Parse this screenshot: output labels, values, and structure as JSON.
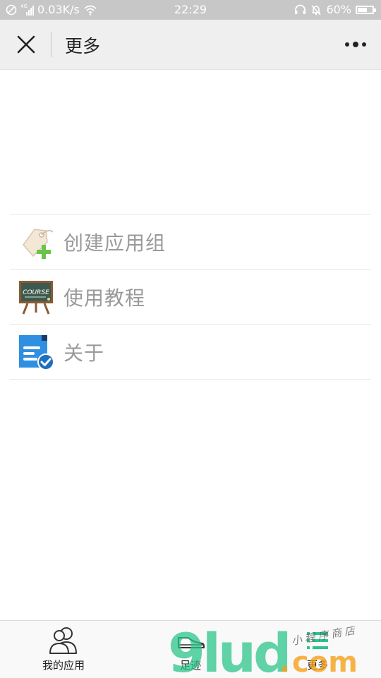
{
  "status_bar": {
    "signal_label": "4G",
    "speed": "0.03K/s",
    "time": "22:29",
    "battery_percent": "60%",
    "battery_level": 0.6
  },
  "navbar": {
    "title": "更多"
  },
  "menu": {
    "items": [
      {
        "label": "创建应用组",
        "icon": "tag-plus-icon"
      },
      {
        "label": "使用教程",
        "icon": "course-blackboard-icon"
      },
      {
        "label": "关于",
        "icon": "document-check-icon"
      }
    ]
  },
  "tabbar": {
    "tabs": [
      {
        "label": "我的应用",
        "icon": "users-icon"
      },
      {
        "label": "足迹",
        "icon": "shoe-icon"
      },
      {
        "label": "更多",
        "icon": "list-icon"
      }
    ]
  },
  "watermark": {
    "brand": "9lud",
    "dot": ".",
    "tld": "com",
    "tagline": "小程序商店"
  },
  "colors": {
    "status_bar_bg": "#c7c7c7",
    "nav_bg": "#efefef",
    "menu_text": "#9a9a9a",
    "watermark_green": "#2bc48a",
    "watermark_orange": "#f6a019"
  }
}
